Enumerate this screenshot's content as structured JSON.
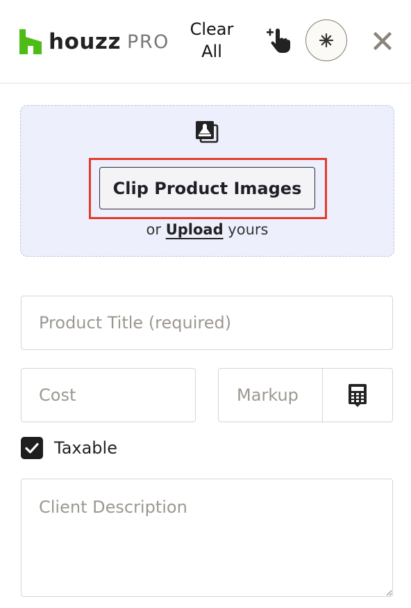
{
  "header": {
    "logo_word": "houzz",
    "logo_suffix": "PRO",
    "clear_all_line1": "Clear",
    "clear_all_line2": "All",
    "icons": [
      "add-pointer-hand-icon",
      "sparkle-icon",
      "close-icon"
    ]
  },
  "dropzone": {
    "icon": "image-stack-icon",
    "clip_button_label": "Clip Product Images",
    "upload_prefix": "or",
    "upload_link": "Upload",
    "upload_suffix": "yours"
  },
  "form": {
    "title_placeholder": "Product Title (required)",
    "cost_placeholder": "Cost",
    "markup_placeholder": "Markup",
    "calculator_icon": "calculator-icon",
    "taxable_label": "Taxable",
    "taxable_checked": true,
    "description_placeholder": "Client Description"
  },
  "colors": {
    "brand_green": "#4dbc15",
    "highlight_red": "#e53a2a",
    "dropzone_bg": "#edf0fc"
  }
}
